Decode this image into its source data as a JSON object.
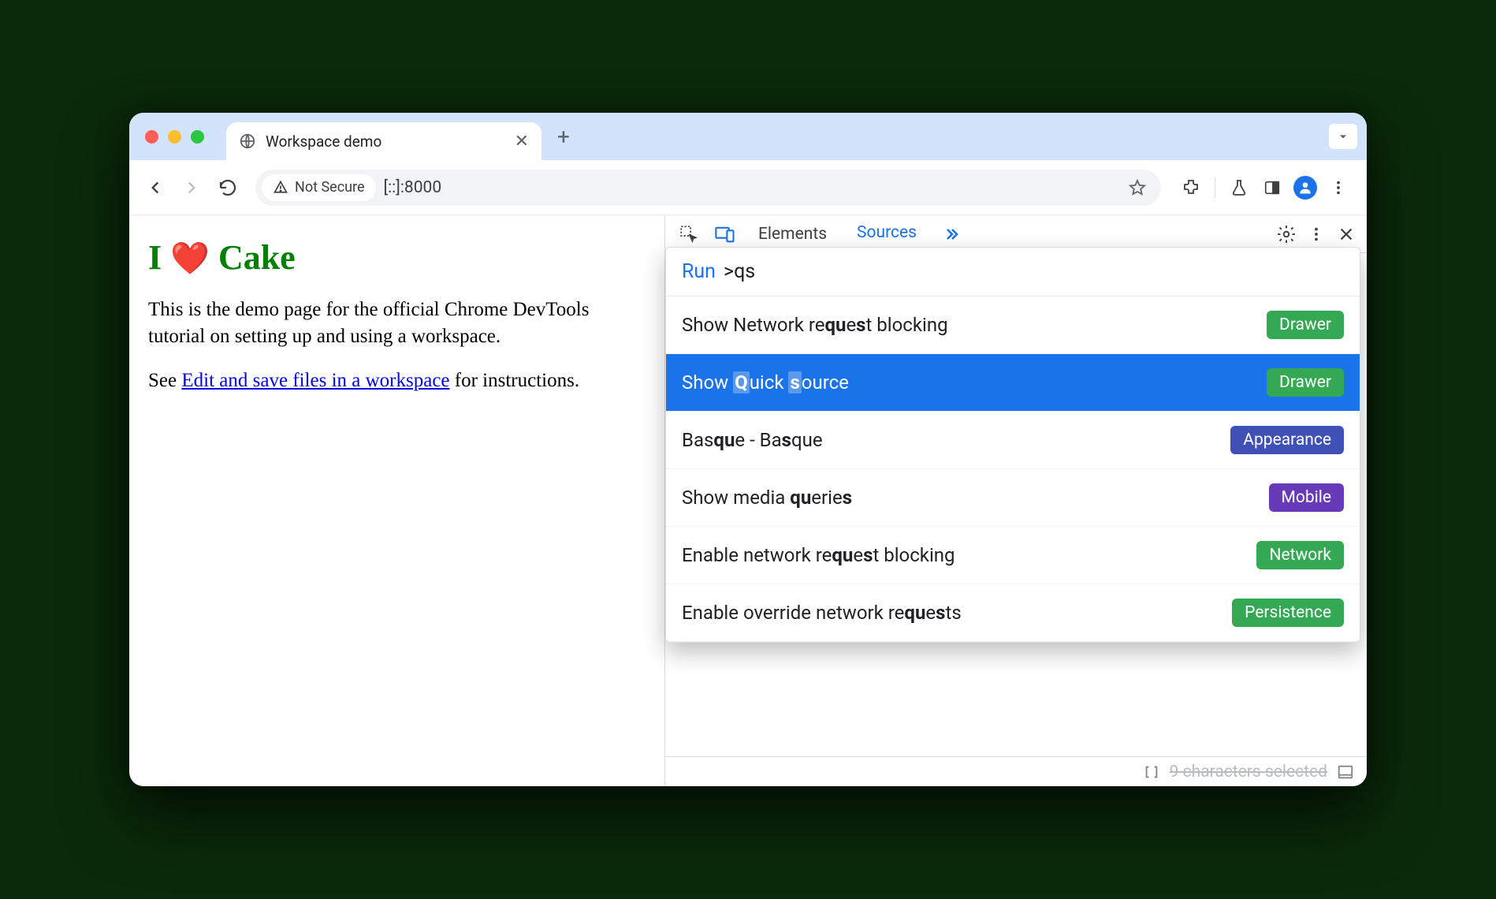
{
  "browser": {
    "tab_title": "Workspace demo",
    "not_secure_label": "Not Secure",
    "address": "[::]:8000"
  },
  "page": {
    "heading_prefix": "I ",
    "heading_heart": "❤️",
    "heading_suffix": " Cake",
    "para1": "This is the demo page for the official Chrome DevTools tutorial on setting up and using a workspace.",
    "para2_prefix": "See ",
    "para2_link": "Edit and save files in a workspace",
    "para2_suffix": " for instructions."
  },
  "devtools": {
    "tab_elements": "Elements",
    "tab_sources": "Sources",
    "cmd_run": "Run",
    "cmd_prefix": ">",
    "cmd_query": "qs",
    "items": [
      {
        "pre": "Show Network re",
        "m1": "qu",
        "mid1": "e",
        "m2": "s",
        "mid2": "t blocking",
        "badge": "Drawer",
        "badgeClass": "drawer"
      },
      {
        "pre": "Show ",
        "m1": "Q",
        "mid1": "uick ",
        "m2": "s",
        "mid2": "ource",
        "badge": "Drawer",
        "badgeClass": "drawer",
        "selected": true
      },
      {
        "pre": "Bas",
        "m1": "qu",
        "mid1": "e - Ba",
        "m2": "s",
        "mid2": "que",
        "badge": "Appearance",
        "badgeClass": "appearance"
      },
      {
        "pre": "Show media ",
        "m1": "qu",
        "mid1": "erie",
        "m2": "s",
        "mid2": "",
        "badge": "Mobile",
        "badgeClass": "mobile"
      },
      {
        "pre": "Enable network re",
        "m1": "qu",
        "mid1": "e",
        "m2": "s",
        "mid2": "t blocking",
        "badge": "Network",
        "badgeClass": "network"
      },
      {
        "pre": "Enable override network re",
        "m1": "qu",
        "mid1": "e",
        "m2": "s",
        "mid2": "ts",
        "badge": "Persistence",
        "badgeClass": "persistence"
      }
    ],
    "footer_text": "9 characters selected"
  }
}
